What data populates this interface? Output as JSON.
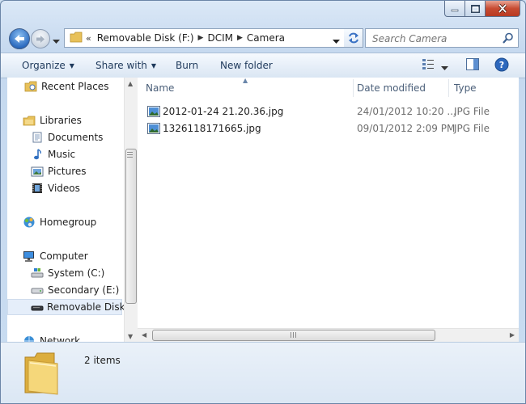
{
  "window": {
    "caption_buttons": [
      "minimize",
      "maximize",
      "close"
    ]
  },
  "address": {
    "overflow": "«",
    "crumbs": [
      "Removable Disk (F:)",
      "DCIM",
      "Camera"
    ],
    "search_placeholder": "Search Camera"
  },
  "toolbar": {
    "organize": "Organize",
    "share_with": "Share with",
    "burn": "Burn",
    "new_folder": "New folder"
  },
  "nav": {
    "recent_places": "Recent Places",
    "libraries": "Libraries",
    "documents": "Documents",
    "music": "Music",
    "pictures": "Pictures",
    "videos": "Videos",
    "homegroup": "Homegroup",
    "computer": "Computer",
    "system": "System (C:)",
    "secondary": "Secondary (E:)",
    "removable": "Removable Disk",
    "network": "Network"
  },
  "columns": {
    "name": "Name",
    "date": "Date modified",
    "type": "Type"
  },
  "files": [
    {
      "name": "2012-01-24 21.20.36.jpg",
      "date": "24/01/2012 10:20 ...",
      "type": "JPG File"
    },
    {
      "name": "1326118171665.jpg",
      "date": "09/01/2012 2:09 PM",
      "type": "JPG File"
    }
  ],
  "status": {
    "count": "2 items"
  },
  "colors": {
    "accent": "#2d6cc0",
    "link_text": "#1e395b",
    "header_text": "#4c607a",
    "meta_text": "#6d6d6d"
  }
}
